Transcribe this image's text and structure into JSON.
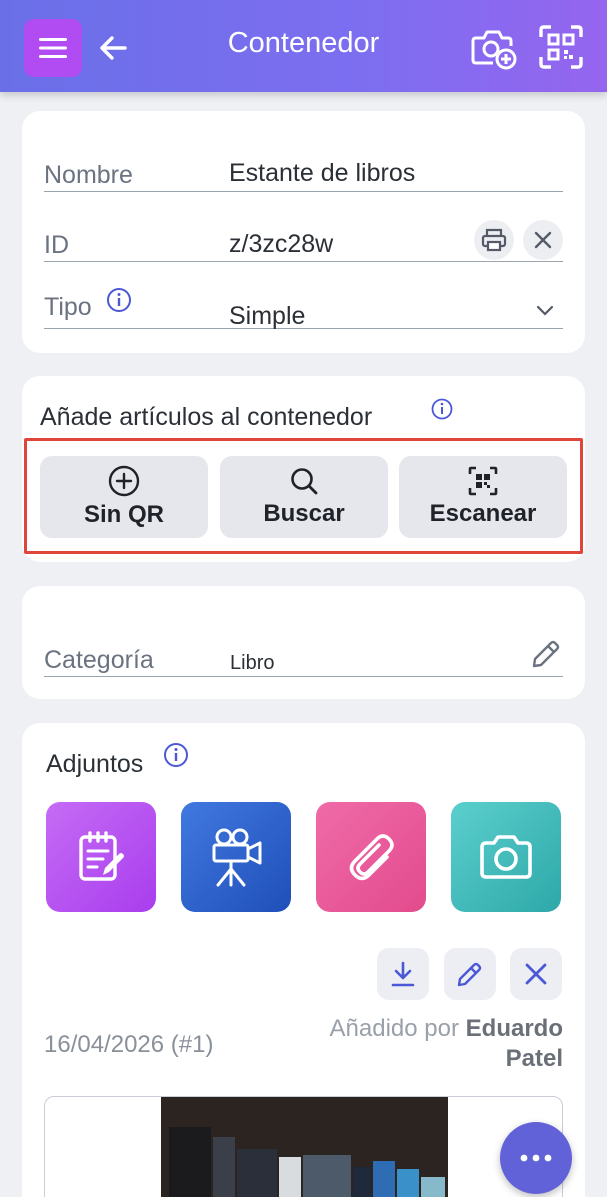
{
  "header": {
    "title": "Contenedor"
  },
  "container": {
    "name_label": "Nombre",
    "name_value": "Estante de libros",
    "id_label": "ID",
    "id_value": "z/3zc28w",
    "type_label": "Tipo",
    "type_value": "Simple"
  },
  "add_items": {
    "title": "Añade artículos al contenedor",
    "buttons": [
      {
        "label": "Sin QR",
        "icon": "plus-circle-icon"
      },
      {
        "label": "Buscar",
        "icon": "search-icon"
      },
      {
        "label": "Escanear",
        "icon": "qr-scan-icon"
      }
    ]
  },
  "category": {
    "label": "Categoría",
    "value": "Libro"
  },
  "attachments": {
    "title": "Adjuntos",
    "tiles": [
      {
        "icon": "note-icon",
        "color": "#b64bf0"
      },
      {
        "icon": "video-camera-icon",
        "color": "#2f63c9"
      },
      {
        "icon": "paperclip-icon",
        "color": "#e9559a"
      },
      {
        "icon": "camera-icon",
        "color": "#3fb8b8"
      }
    ],
    "entry": {
      "date": "16/04/2026 (#1)",
      "added_by_prefix": "Añadido por",
      "added_by_first": "Eduardo",
      "added_by_last": "Patel"
    }
  },
  "colors": {
    "header_start": "#6a6fe8",
    "header_end": "#9565ef",
    "accent": "#6162d8",
    "highlight": "#e0453a"
  }
}
